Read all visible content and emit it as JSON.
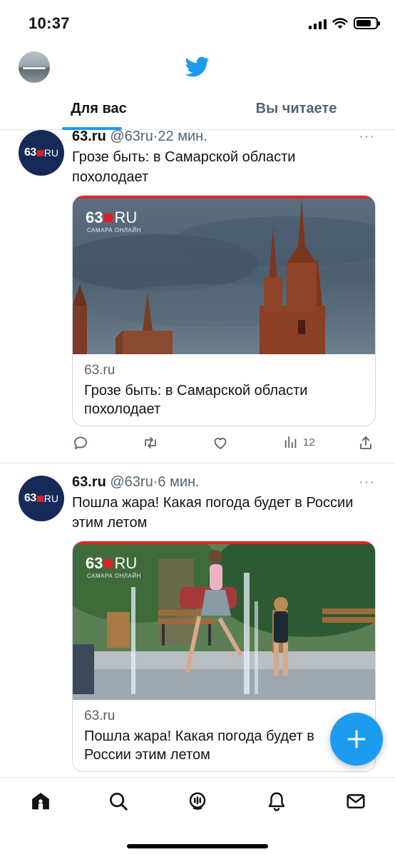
{
  "status_bar": {
    "time": "10:37"
  },
  "tabs": [
    {
      "label": "Для вас",
      "active": true
    },
    {
      "label": "Вы читаете",
      "active": false
    }
  ],
  "tweets": [
    {
      "name": "63.ru",
      "handle": "@63ru",
      "separator": "·",
      "time": "22 мин.",
      "text": "Грозе быть: в Самарской области похолодает",
      "avatar_logo": {
        "num": "63",
        "ru": "RU"
      },
      "card": {
        "image_logo": "63",
        "image_logo_ru": "RU",
        "image_logo_sub": "САМАРА ОНЛАЙН",
        "domain": "63.ru",
        "title": "Грозе быть: в Самарской области похолодает"
      },
      "stats": {
        "views": "12"
      }
    },
    {
      "name": "63.ru",
      "handle": "@63ru",
      "separator": "·",
      "time": "6 мин.",
      "text": "Пошла жара! Какая погода будет в России этим летом",
      "avatar_logo": {
        "num": "63",
        "ru": "RU"
      },
      "card": {
        "image_logo": "63",
        "image_logo_ru": "RU",
        "image_logo_sub": "САМАРА ОНЛАЙН",
        "domain": "63.ru",
        "title": "Пошла жара! Какая погода будет в России этим летом"
      }
    }
  ],
  "more_glyph": "···",
  "icons": {
    "header": [
      "profile-avatar",
      "twitter-bird-icon"
    ],
    "actions": [
      "reply-icon",
      "retweet-icon",
      "like-icon",
      "views-icon",
      "share-icon"
    ],
    "nav": [
      "home-icon",
      "search-icon",
      "spaces-icon",
      "notifications-icon",
      "messages-icon"
    ],
    "fab": "compose-plus-icon"
  },
  "colors": {
    "accent": "#1d9bf0",
    "brand_navy": "#162a57",
    "brand_red": "#e11d2b"
  }
}
